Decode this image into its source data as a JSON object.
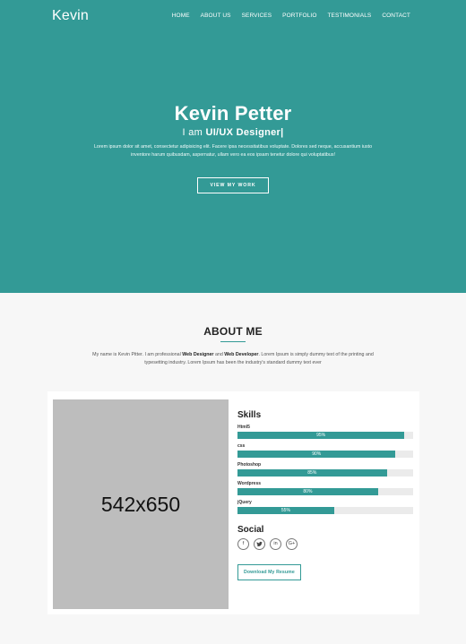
{
  "nav": {
    "brand": "Kevin",
    "items": [
      {
        "label": "HOME"
      },
      {
        "label": "ABOUT US"
      },
      {
        "label": "SERVICES"
      },
      {
        "label": "PORTFOLIO"
      },
      {
        "label": "TESTIMONIALS"
      },
      {
        "label": "CONTACT"
      }
    ]
  },
  "hero": {
    "title": "Kevin Petter",
    "subtitle_prefix": "I am ",
    "subtitle_role": "UI/UX Designer|",
    "text": "Lorem ipsum dolor sit amet, consectetur adipisicing elit. Facere ipsa necessitatibus voluptate. Dolores sed neque, accusantium iusto inventore harum quibusdam, aspernatur, ullam vero ea eos ipsam tenetur dolore qui voluptatibus!",
    "button_label": "VIEW MY WORK",
    "background_color": "#339a96"
  },
  "about": {
    "title": "ABOUT ME",
    "text_part1": "My name is Kevin Pitter. I am professional ",
    "text_bold1": "Web Designer",
    "text_part2": " and ",
    "text_bold2": "Web Developer",
    "text_part3": ". Lorem Ipsum is simply dummy text of the printing and typesetting industry. Lorem Ipsum has been the industry's standard dummy text ever",
    "image_placeholder": "542x650",
    "skills_title": "Skills",
    "skills": [
      {
        "name": "Html5",
        "percent": 95,
        "label": "95%"
      },
      {
        "name": "css",
        "percent": 90,
        "label": "90%"
      },
      {
        "name": "Photoshop",
        "percent": 85,
        "label": "85%"
      },
      {
        "name": "Wordpress",
        "percent": 80,
        "label": "80%"
      },
      {
        "name": "jQuery",
        "percent": 55,
        "label": "55%"
      }
    ],
    "social_title": "Social",
    "social": [
      {
        "icon": "facebook-icon",
        "glyph": "f"
      },
      {
        "icon": "twitter-icon",
        "glyph": "🐦"
      },
      {
        "icon": "linkedin-icon",
        "glyph": "in"
      },
      {
        "icon": "google-plus-icon",
        "glyph": "G+"
      }
    ],
    "resume_label": "Download My Resume"
  },
  "colors": {
    "accent": "#339a96",
    "track": "#ebebeb",
    "placeholder": "#bdbdbd"
  }
}
